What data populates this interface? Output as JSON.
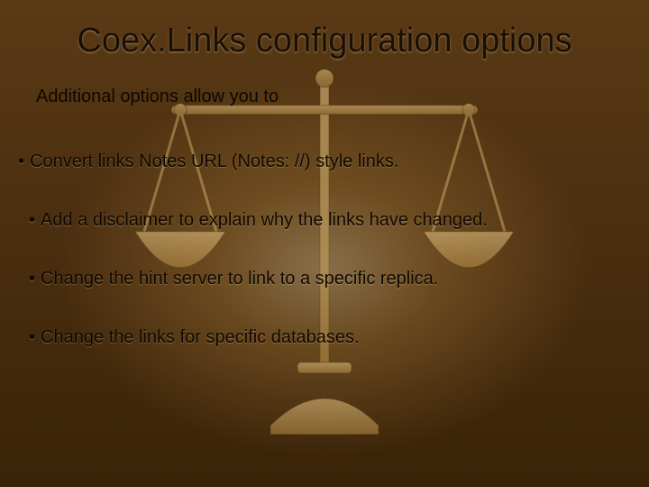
{
  "title": "Coex.Links configuration options",
  "subtitle": "Additional options allow you to",
  "bullets": [
    {
      "text": "Convert links Notes URL (Notes: //) style links.",
      "indent": false
    },
    {
      "text": "Add a disclaimer to explain why the links have changed.",
      "indent": true
    },
    {
      "text": "Change the hint server to link to a specific replica.",
      "indent": true
    },
    {
      "text": "Change the links for specific databases.",
      "indent": true
    }
  ]
}
